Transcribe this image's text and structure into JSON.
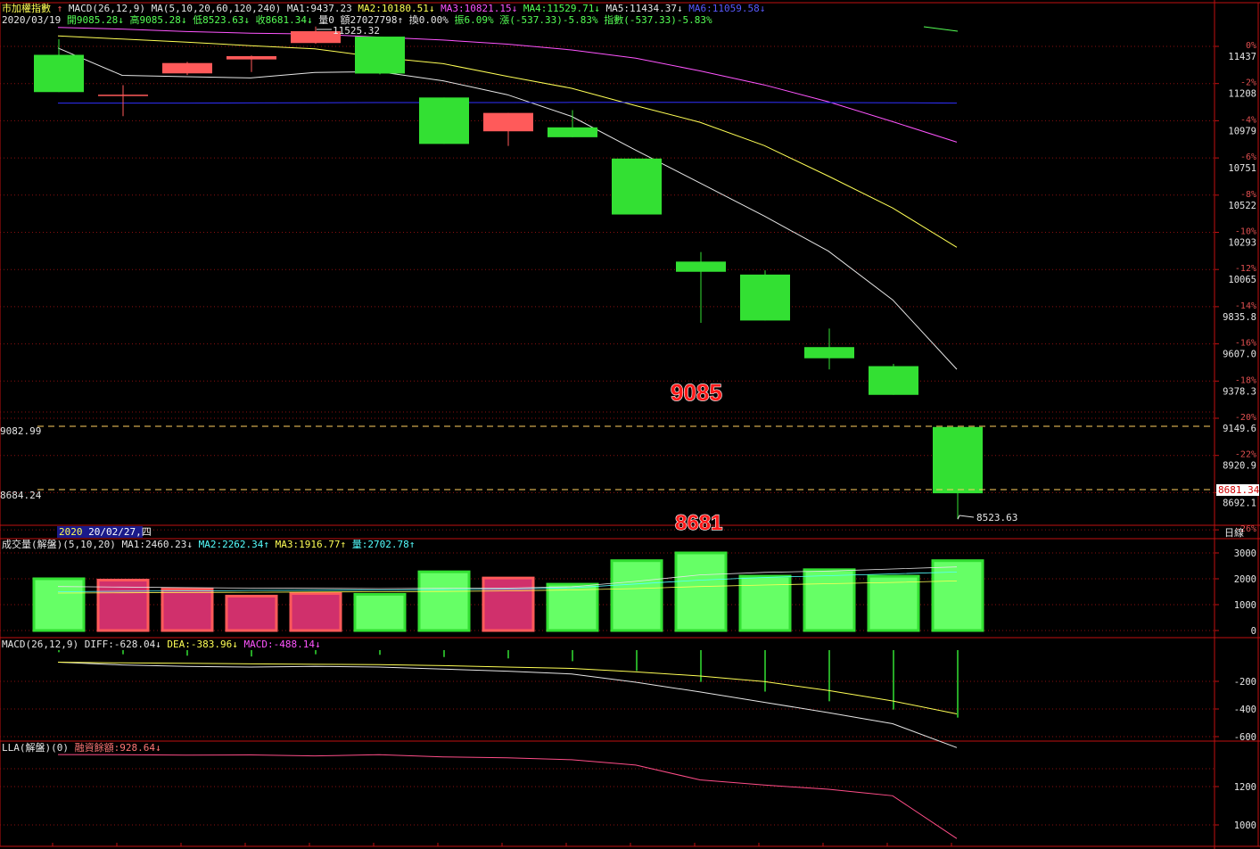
{
  "header": {
    "symbol": "市加權指數",
    "up_arrow": "↑",
    "indicators": "MACD(26,12,9) MA(5,10,20,60,120,240)",
    "ma_values": [
      {
        "label": "MA1:9437.23",
        "color": "#e6e6e6"
      },
      {
        "label": "MA2:10180.51↓",
        "color": "#ffff55"
      },
      {
        "label": "MA3:10821.15↓",
        "color": "#ff55ff"
      },
      {
        "label": "MA4:11529.71↓",
        "color": "#55ff55"
      },
      {
        "label": "MA5:11434.37↓",
        "color": "#e6e6e6"
      },
      {
        "label": "MA6:11059.58↓",
        "color": "#5a5aff"
      }
    ],
    "date": "2020/03/19",
    "ohlc": [
      {
        "label": "開9085.28↓",
        "color": "#55ff55"
      },
      {
        "label": "高9085.28↓",
        "color": "#55ff55"
      },
      {
        "label": "低8523.63↓",
        "color": "#55ff55"
      },
      {
        "label": "收8681.34↓",
        "color": "#55ff55"
      },
      {
        "label": "量0",
        "color": "#e6e6e6"
      },
      {
        "label": "額27027798↑",
        "color": "#e6e6e6"
      },
      {
        "label": "換0.00%",
        "color": "#e6e6e6"
      },
      {
        "label": "振6.09%",
        "color": "#55ff55"
      },
      {
        "label": "漲(-537.33)-5.83%",
        "color": "#55ff55"
      },
      {
        "label": "指數(-537.33)-5.83%",
        "color": "#55ff55"
      }
    ]
  },
  "price_panel": {
    "axis_labels": [
      {
        "pct": "0%",
        "price": "11437"
      },
      {
        "pct": "-2%",
        "price": "11208"
      },
      {
        "pct": "-4%",
        "price": "10979"
      },
      {
        "pct": "-6%",
        "price": "10751"
      },
      {
        "pct": "-8%",
        "price": "10522"
      },
      {
        "pct": "-10%",
        "price": "10293"
      },
      {
        "pct": "-12%",
        "price": "10065"
      },
      {
        "pct": "-14%",
        "price": "9835.8"
      },
      {
        "pct": "-16%",
        "price": "9607.0"
      },
      {
        "pct": "-18%",
        "price": "9378.3"
      },
      {
        "pct": "-20%",
        "price": "9149.6"
      },
      {
        "pct": "-22%",
        "price": "8920.9"
      },
      {
        "pct": "-24%",
        "price": "8692.1"
      },
      {
        "pct": "-26%",
        "price": ""
      }
    ],
    "high_label": "11525.32",
    "low_label": "8523.63",
    "left_ref_top": "9082.99",
    "left_ref_bottom": "8684.24",
    "current_price_tag": "8681.34",
    "annotation_open": "9085",
    "annotation_close": "8681",
    "date_cursor_prefix": "2020",
    "date_cursor": "20/02/27,四",
    "period_label": "日線"
  },
  "candles": [
    {
      "o": 11353,
      "h": 11448,
      "l": 11187,
      "c": 11126
    },
    {
      "o": 11110,
      "h": 11168,
      "l": 10979,
      "c": 11110
    },
    {
      "o": 11240,
      "h": 11310,
      "l": 11230,
      "c": 11303
    },
    {
      "o": 11325,
      "h": 11349,
      "l": 11248,
      "c": 11345
    },
    {
      "o": 11425,
      "h": 11525.32,
      "l": 11420,
      "c": 11497
    },
    {
      "o": 11464,
      "h": 11464,
      "l": 11234,
      "c": 11239
    },
    {
      "o": 11093,
      "h": 11093,
      "l": 10810,
      "c": 10810
    },
    {
      "o": 10887,
      "h": 10918,
      "l": 10798,
      "c": 10999
    },
    {
      "o": 10911,
      "h": 11016,
      "l": 10853,
      "c": 10851
    },
    {
      "o": 10721,
      "h": 10721,
      "l": 10387,
      "c": 10380
    },
    {
      "o": 10093,
      "h": 10151,
      "l": 9720,
      "c": 10031
    },
    {
      "o": 10014,
      "h": 10040,
      "l": 9734,
      "c": 9734
    },
    {
      "o": 9572,
      "h": 9685,
      "l": 9436,
      "c": 9504
    },
    {
      "o": 9456,
      "h": 9470,
      "l": 9281,
      "c": 9281
    },
    {
      "o": 9085.28,
      "h": 9085.28,
      "l": 8523.63,
      "c": 8681.34
    }
  ],
  "ma_lines": {
    "ma1": [
      11395,
      11228,
      11220,
      11212,
      11246,
      11250,
      11195,
      11110,
      10978,
      10772,
      10572,
      10371,
      10157,
      9860,
      9437
    ],
    "ma2": [
      11468,
      11449,
      11430,
      11409,
      11390,
      11338,
      11299,
      11222,
      11149,
      11043,
      10942,
      10800,
      10614,
      10420,
      10180
    ],
    "ma3": [
      11520,
      11510,
      11495,
      11485,
      11480,
      11461,
      11443,
      11418,
      11383,
      11333,
      11255,
      11170,
      11067,
      10946,
      10821
    ],
    "ma6": [
      11059,
      11059,
      11059,
      11060,
      11061,
      11062,
      11062,
      11062,
      11063,
      11063,
      11063,
      11063,
      11062,
      11061,
      11059
    ]
  },
  "volume_panel": {
    "header": [
      {
        "label": "成交量(解盤)(5,10,20)",
        "color": "#e6e6e6"
      },
      {
        "label": "MA1:2460.23↓",
        "color": "#e6e6e6"
      },
      {
        "label": "MA2:2262.34↑",
        "color": "#55ffff"
      },
      {
        "label": "MA3:1916.77↑",
        "color": "#ffff55"
      },
      {
        "label": "量:2702.78↑",
        "color": "#55ffff"
      }
    ],
    "axis_labels": [
      "3000",
      "2000",
      "1000",
      "0"
    ],
    "volumes": [
      2000,
      1950,
      1600,
      1330,
      1430,
      1400,
      2270,
      2030,
      1790,
      2700,
      3000,
      2100,
      2350,
      2100,
      2700
    ],
    "ma1": [
      1700,
      1680,
      1660,
      1640,
      1630,
      1620,
      1630,
      1640,
      1690,
      1900,
      2150,
      2250,
      2300,
      2380,
      2460
    ],
    "ma2": [
      1500,
      1520,
      1530,
      1550,
      1560,
      1570,
      1580,
      1600,
      1650,
      1800,
      1950,
      2050,
      2120,
      2190,
      2262
    ],
    "ma3": [
      1450,
      1460,
      1470,
      1480,
      1490,
      1500,
      1510,
      1530,
      1570,
      1620,
      1700,
      1760,
      1810,
      1860,
      1917
    ]
  },
  "macd_panel": {
    "header": [
      {
        "label": "MACD(26,12,9)",
        "color": "#e6e6e6"
      },
      {
        "label": "DIFF:-628.04↓",
        "color": "#e6e6e6"
      },
      {
        "label": "DEA:-383.96↓",
        "color": "#ffff55"
      },
      {
        "label": "MACD:-488.14↓",
        "color": "#ff55ff"
      }
    ],
    "axis_labels": [
      "-200",
      "-400",
      "-600"
    ],
    "diff": [
      -10,
      -30,
      -40,
      -45,
      -40,
      -45,
      -60,
      -75,
      -95,
      -155,
      -225,
      -300,
      -375,
      -455,
      -628
    ],
    "dea": [
      -10,
      -15,
      -18,
      -22,
      -25,
      -28,
      -35,
      -45,
      -55,
      -80,
      -110,
      -150,
      -215,
      -290,
      -384
    ],
    "macd": [
      -15,
      -30,
      -40,
      -46,
      -30,
      -34,
      -50,
      -60,
      -80,
      -150,
      -230,
      -300,
      -370,
      -430,
      -488
    ]
  },
  "lla_panel": {
    "header": [
      {
        "label": "LLA(解盤)(0)",
        "color": "#e6e6e6"
      },
      {
        "label": "融資餘額:928.64↓",
        "color": "#ff7777"
      }
    ],
    "axis_labels": [
      "1200",
      "1000"
    ],
    "values": [
      1367,
      1366,
      1364,
      1365,
      1360,
      1366,
      1355,
      1350,
      1340,
      1312,
      1235,
      1208,
      1186,
      1152,
      928.64
    ]
  },
  "colors": {
    "up": "#ff5a5a",
    "down": "#33e033",
    "vol_up_fill": "#d0306c",
    "vol_down_fill": "#66ff66",
    "grid": "#8a1010",
    "border": "#c01010",
    "accent_red": "#ff2020"
  }
}
